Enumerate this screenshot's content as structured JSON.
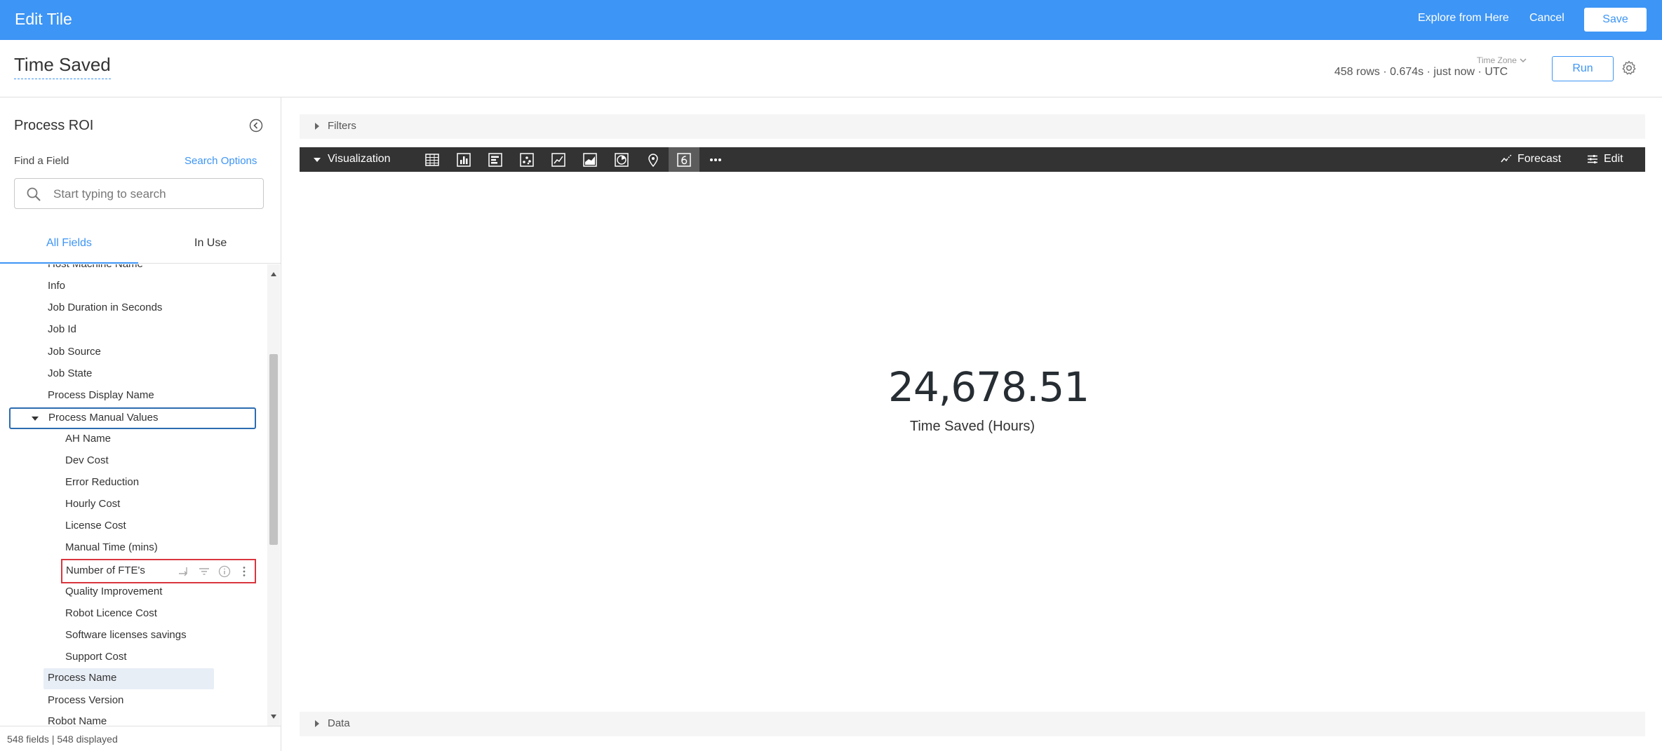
{
  "header": {
    "title": "Edit Tile",
    "explore_link": "Explore from Here",
    "cancel": "Cancel",
    "save": "Save"
  },
  "look": {
    "title": "Time Saved",
    "time_zone_label": "Time Zone",
    "run_meta": "458 rows · 0.674s · just now · UTC",
    "run_button": "Run"
  },
  "sidebar": {
    "explore_name": "Process ROI",
    "find_label": "Find a Field",
    "search_options": "Search Options",
    "search_placeholder": "Start typing to search",
    "tabs": [
      "All Fields",
      "In Use"
    ],
    "fields_top": [
      "Host Machine Name",
      "Info",
      "Job Duration in Seconds",
      "Job Id",
      "Job Source",
      "Job State",
      "Process Display Name"
    ],
    "group": "Process Manual Values",
    "group_fields": [
      "AH Name",
      "Dev Cost",
      "Error Reduction",
      "Hourly Cost",
      "License Cost",
      "Manual Time (mins)",
      "Number of FTE's",
      "Quality Improvement",
      "Robot Licence Cost",
      "Software licenses savings",
      "Support Cost"
    ],
    "fields_bottom": [
      "Process Name",
      "Process Version",
      "Robot Name"
    ],
    "footer": "548 fields | 548 displayed"
  },
  "sections": {
    "filters": "Filters",
    "visualization": "Visualization",
    "data": "Data",
    "forecast": "Forecast",
    "edit": "Edit"
  },
  "viz_icons": [
    "table-icon",
    "column-chart-icon",
    "bar-chart-icon",
    "scatter-icon",
    "line-chart-icon",
    "area-chart-icon",
    "pie-chart-icon",
    "map-pin-icon",
    "single-value-icon",
    "more-icon"
  ],
  "single_value": {
    "value": "24,678.51",
    "label": "Time Saved (Hours)"
  },
  "colors": {
    "accent": "#3d95f5",
    "viz_bar": "#333333",
    "highlight_border": "#d9363e",
    "group_border": "#2b6cb0"
  }
}
